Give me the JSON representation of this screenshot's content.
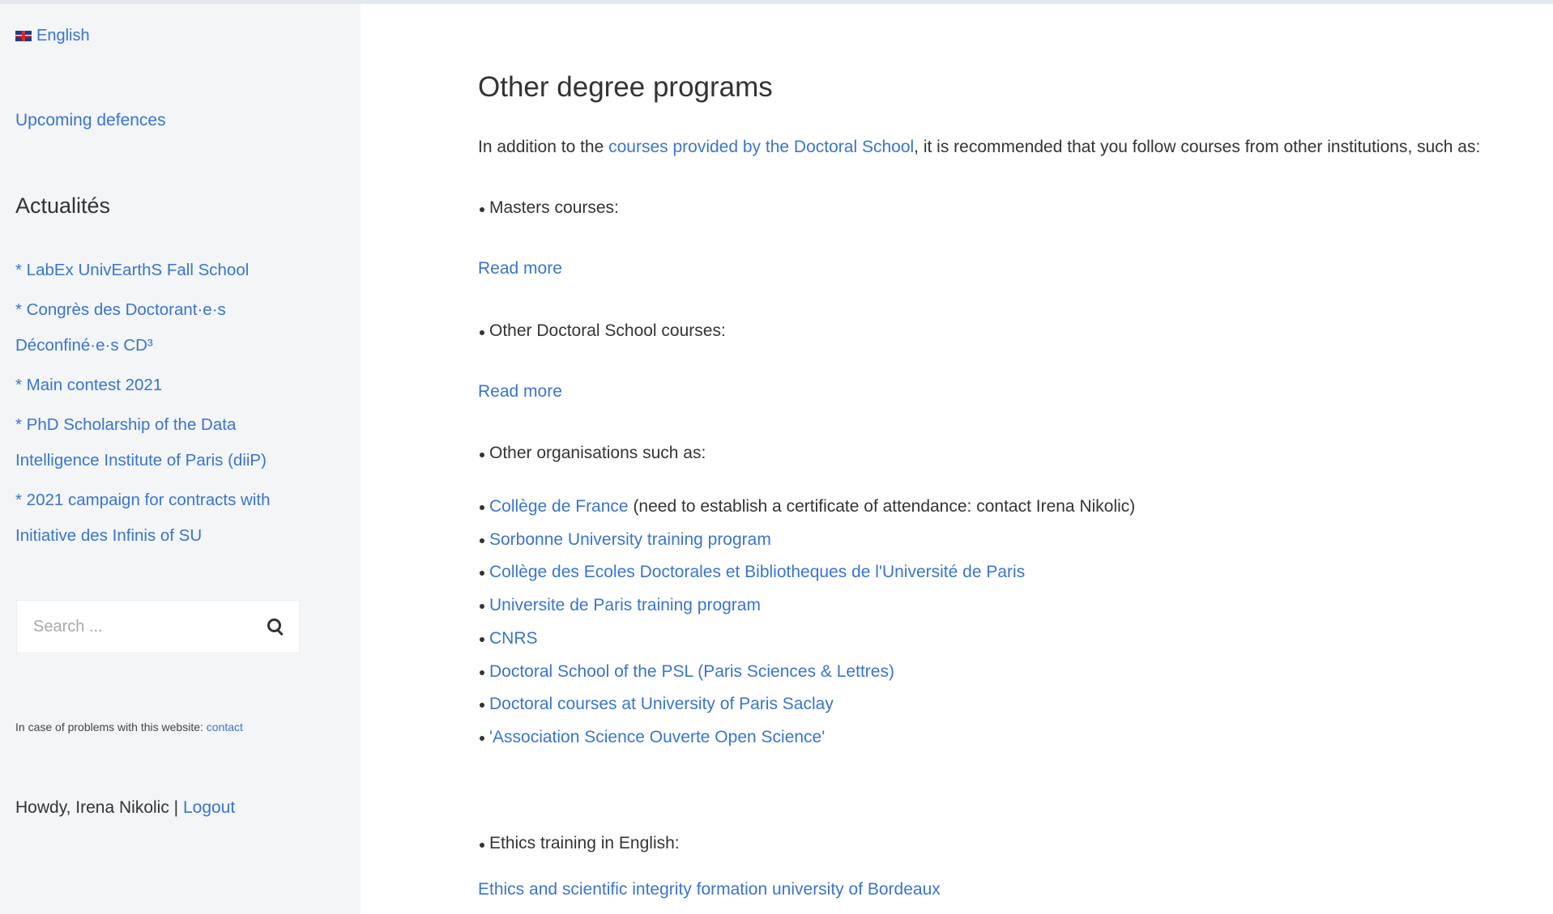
{
  "sidebar": {
    "language": "English",
    "upcoming_defences": "Upcoming defences",
    "news_heading": "Actualités",
    "news": [
      "* LabEx UnivEarthS Fall School",
      "* Congrès des Doctorant·e·s Déconfiné·e·s CD³",
      "* Main contest 2021",
      "* PhD Scholarship of the Data Intelligence Institute of Paris (diiP)",
      "* 2021 campaign for contracts with Initiative des Infinis of SU"
    ],
    "search_placeholder": "Search ...",
    "problems_text": "In case of problems with this website: ",
    "problems_link": "contact",
    "howdy_text": "Howdy, Irena Nikolic | ",
    "logout": "Logout"
  },
  "main": {
    "heading": "Other degree programs",
    "intro_before": "In addition to the ",
    "intro_link": "courses provided by the Doctoral School",
    "intro_after": ", it is recommended that you follow courses from other institutions, such as:",
    "masters": "Masters courses:",
    "read_more_1": "Read more",
    "other_ds": "Other Doctoral School courses:",
    "read_more_2": "Read more",
    "other_orgs": "Other organisations such as:",
    "orgs": [
      {
        "link": "Collège de France",
        "note": " (need to establish a certificate of attendance: contact Irena Nikolic)"
      },
      {
        "link": "Sorbonne University training program",
        "note": ""
      },
      {
        "link": "Collège des Ecoles Doctorales et Bibliotheques de l'Université de Paris",
        "note": ""
      },
      {
        "link": "Universite de Paris training program",
        "note": ""
      },
      {
        "link": "CNRS",
        "note": ""
      },
      {
        "link": "Doctoral School of the PSL  (Paris Sciences & Lettres)",
        "note": ""
      },
      {
        "link": "Doctoral courses at University of Paris Saclay",
        "note": ""
      },
      {
        "link": "'Association Science Ouverte Open Science'",
        "note": ""
      }
    ],
    "ethics": "Ethics  training in English:",
    "ethics_link": "Ethics and scientific integrity formation university of Bordeaux"
  }
}
